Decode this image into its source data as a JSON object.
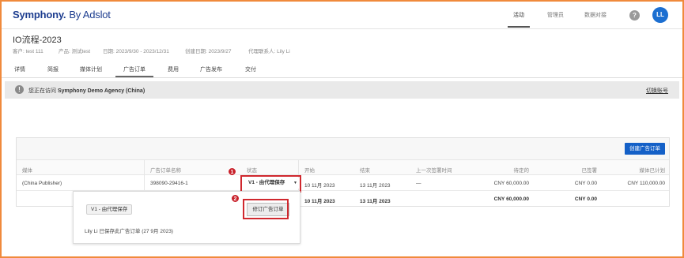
{
  "header": {
    "logo_brand": "Symphony.",
    "logo_suffix": "By Adslot",
    "nav": [
      "活动",
      "管理员",
      "数据对接"
    ],
    "help_glyph": "?",
    "avatar_initials": "LL"
  },
  "page": {
    "title": "IO流程-2023",
    "meta": [
      "客户: test 111",
      "产品: 测试test",
      "日期: 2023/9/30 - 2023/12/31",
      "创建日期: 2023/9/27",
      "代理联系人: Lily Li"
    ]
  },
  "tabs": [
    "详情",
    "简报",
    "媒体计划",
    "广告订单",
    "费用",
    "广告发布",
    "交付"
  ],
  "active_tab": "广告订单",
  "notice": {
    "icon_glyph": "!",
    "prefix": "您正在访问",
    "agency": "Symphony Demo Agency (China)",
    "switch_label": "切换账号"
  },
  "panel": {
    "create_button": "创建广告订单",
    "columns": [
      "媒体",
      "广告订单名称",
      "状态",
      "开始",
      "结束",
      "上一次签署时间",
      "待定的",
      "已签署",
      "媒体已计划"
    ],
    "row": {
      "media": "(China Publisher)",
      "order_name": "398090-29416-1",
      "status": "V1 - 由代理保存",
      "status_caret": "▼",
      "start": "10 11月 2023",
      "end": "13 11月 2023",
      "last_signed": "—",
      "pending": "CNY 60,000.00",
      "signed": "CNY 0.00",
      "planned": "CNY 110,000.00"
    },
    "total_row": {
      "start": "10 11月 2023",
      "end": "13 11月 2023",
      "pending": "CNY 60,000.00",
      "signed": "CNY 0.00"
    }
  },
  "popover": {
    "version_chip": "V1 - 由代理保存",
    "revise_button": "修订广告订单",
    "saved_text": "Lily Li 已保存此广告订单 (27 9月 2023)"
  },
  "annotations": {
    "badge_1": "1",
    "badge_2": "2",
    "highlight_color": "#d0282e"
  },
  "colors": {
    "brand": "#1d3d8f",
    "primary_button": "#1460c7",
    "avatar": "#1c6fd1",
    "frame_border": "#f08a3c"
  }
}
